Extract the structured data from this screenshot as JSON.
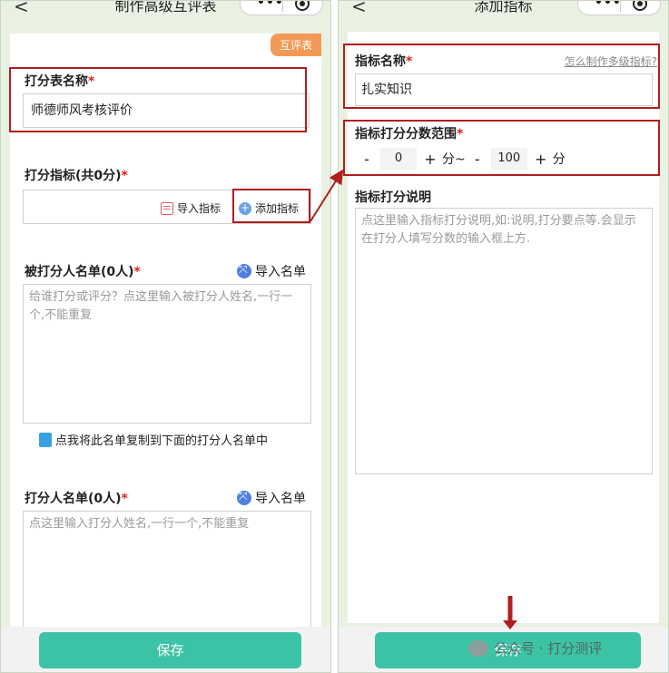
{
  "left": {
    "nav_back": "<",
    "nav_title": "制作高级互评表",
    "capsule_dots": "•••",
    "tag": "互评表",
    "sheet_name_label": "打分表名称",
    "sheet_name_value": "师德师风考核评价",
    "indicators_label": "打分指标(共0分)",
    "import_indicators": "导入指标",
    "add_indicator": "添加指标",
    "ratees_label": "被打分人名单(0人)",
    "import_list_1": "导入名单",
    "ratees_placeholder": "给谁打分或评分？点这里输入被打分人姓名,一行一个,不能重复",
    "copy_hint": "点我将此名单复制到下面的打分人名单中",
    "raters_label": "打分人名单(0人)",
    "import_list_2": "导入名单",
    "raters_placeholder": "点这里输入打分人姓名,一行一个,不能重复",
    "save": "保存"
  },
  "right": {
    "nav_back": "<",
    "nav_title": "添加指标",
    "capsule_dots": "•••",
    "indicator_name_label": "指标名称",
    "multi_level_link": "怎么制作多级指标?",
    "indicator_name_value": "扎实知识",
    "score_range_label": "指标打分分数范围",
    "minus": "-",
    "plus": "+",
    "min_value": "0",
    "max_value": "100",
    "unit_to": "分~",
    "unit": "分",
    "desc_label": "指标打分说明",
    "desc_placeholder": "点这里输入指标打分说明,如:说明,打分要点等.会显示在打分人填写分数的输入框上方.",
    "save": "保存"
  },
  "required_mark": "*",
  "watermark": "公众号 · 打分测评",
  "colors": {
    "accent": "#3cc3a5",
    "highlight": "#b01e1e",
    "tag": "#f29a55",
    "background": "#e9f1e3"
  }
}
